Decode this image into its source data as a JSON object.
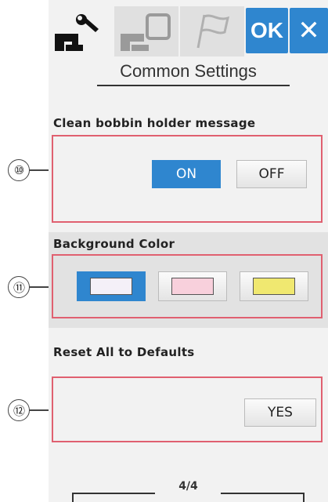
{
  "header": {
    "tabs": [
      {
        "name": "settings-tab",
        "icon": "wrench-sewing-machine-icon",
        "active": true
      },
      {
        "name": "embroidery-tab",
        "icon": "embroidery-hoop-icon",
        "active": false
      },
      {
        "name": "language-tab",
        "icon": "flag-icon",
        "active": false
      }
    ],
    "ok_label": "OK",
    "close_label": "✕"
  },
  "title": "Common Settings",
  "sections": {
    "bobbin": {
      "label": "Clean bobbin holder message",
      "callout": "⑩",
      "on_label": "ON",
      "off_label": "OFF",
      "selected": "ON"
    },
    "background": {
      "label": "Background Color",
      "callout": "⑪",
      "colors": [
        "#f4f0f8",
        "#f8d0dc",
        "#f0e870"
      ],
      "selected_index": 0
    },
    "reset": {
      "label": "Reset All to Defaults",
      "callout": "⑫",
      "yes_label": "YES"
    }
  },
  "page_indicator": "4/4",
  "theme": {
    "accent": "#2f86cf",
    "callout_box": "#e06070"
  }
}
